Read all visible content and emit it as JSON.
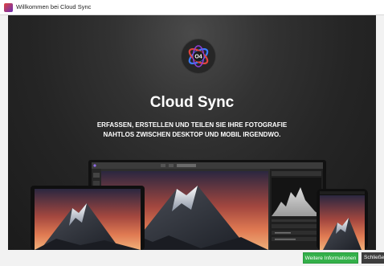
{
  "window": {
    "title": "Willkommen bei Cloud Sync",
    "app_icon": "app-logo-icon"
  },
  "hero": {
    "logo_text": "O4",
    "headline": "Cloud Sync",
    "tagline": "ERFASSEN, ERSTELLEN UND TEILEN SIE IHRE FOTOGRAFIE NAHTLOS ZWISCHEN DESKTOP UND MOBIL IRGENDWO."
  },
  "buttons": {
    "more_info": "Weitere Informationen",
    "close": "Schließen"
  },
  "colors": {
    "accent_green": "#34b04a",
    "dark_button": "#3d3d3d",
    "stage_background": "#252525",
    "logo_ring_blue": "#3a7bff",
    "logo_ring_red": "#e0443d",
    "logo_ring_purple": "#8a3fd6"
  }
}
